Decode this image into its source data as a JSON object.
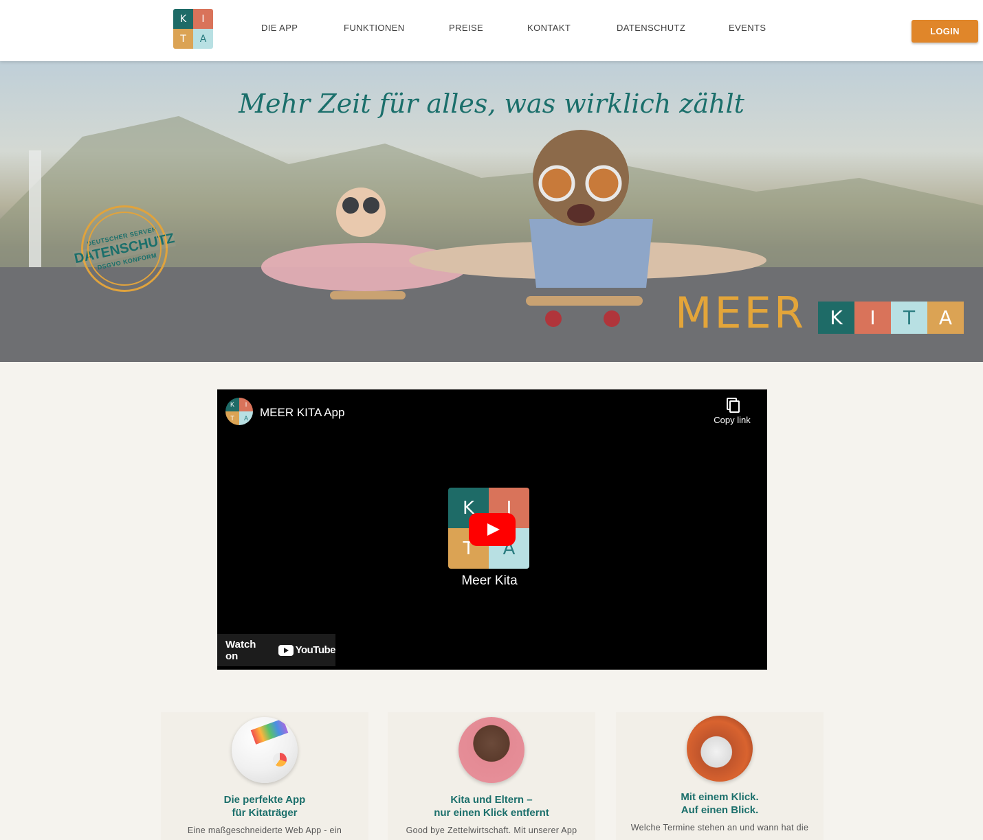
{
  "header": {
    "logo_letters": [
      "K",
      "I",
      "T",
      "A"
    ],
    "nav": [
      "DIE APP",
      "FUNKTIONEN",
      "PREISE",
      "KONTAKT",
      "DATENSCHUTZ",
      "EVENTS"
    ],
    "login_label": "LOGIN"
  },
  "hero": {
    "title": "Mehr Zeit für alles, was wirklich zählt",
    "stamp": {
      "top": "DEUTSCHER SERVER",
      "main": "DATENSCHUTZ",
      "bottom": "DSGVO KONFORM"
    },
    "brand": {
      "word": "MEER",
      "letters": [
        "K",
        "I",
        "T",
        "A"
      ]
    }
  },
  "video": {
    "title": "MEER KITA App",
    "copy_label": "Copy link",
    "channel": "Meer Kita",
    "watch_on": "Watch on",
    "youtube": "YouTube"
  },
  "features": [
    {
      "title_line1": "Die perfekte App",
      "title_line2": "für Kitaträger",
      "text": "Eine maßgeschneiderte Web App - ein"
    },
    {
      "title_line1": "Kita und Eltern –",
      "title_line2": "nur einen Klick entfernt",
      "text": "Good bye Zettelwirtschaft. Mit unserer App"
    },
    {
      "title_line1": "Mit einem Klick.",
      "title_line2": "Auf einen Blick.",
      "text": "Welche Termine stehen an und wann hat die"
    }
  ],
  "colors": {
    "teal": "#1b6f6b",
    "orange": "#e0862a",
    "coral": "#d9735a",
    "sand": "#dba354",
    "aqua": "#b8e0e3"
  }
}
